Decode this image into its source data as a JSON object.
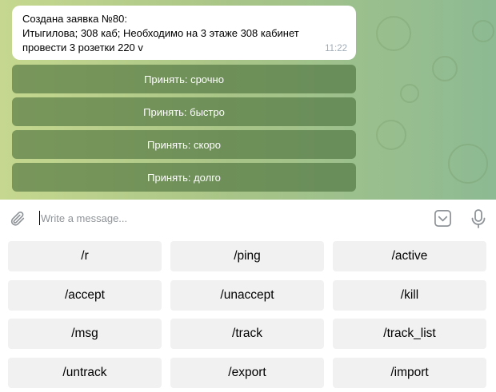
{
  "message": {
    "lines": [
      "Создана заявка №80:",
      "Итыгилова; 308 каб; Необходимо на 3 этаже 308 кабинет",
      "провести 3 розетки 220 v"
    ],
    "time": "11:22"
  },
  "inline_buttons": [
    "Принять: срочно",
    "Принять: быстро",
    "Принять: скоро",
    "Принять: долго"
  ],
  "input": {
    "placeholder": "Write a message..."
  },
  "icons": {
    "attach": "paperclip-icon",
    "keyboard": "keyboard-toggle-icon",
    "voice": "microphone-icon"
  },
  "keyboard": {
    "rows": [
      [
        "/r",
        "/ping",
        "/active"
      ],
      [
        "/accept",
        "/unaccept",
        "/kill"
      ],
      [
        "/msg",
        "/track",
        "/track_list"
      ],
      [
        "/untrack",
        "/export",
        "/import"
      ]
    ]
  },
  "colors": {
    "inline_button_bg": "#4a703c",
    "key_bg": "#f1f1f1",
    "icon_gray": "#8e9398"
  }
}
